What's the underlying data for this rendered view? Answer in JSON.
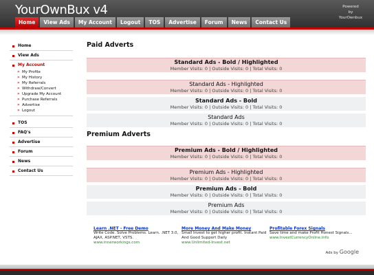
{
  "header": {
    "logo": "YourOwnBux v4",
    "powered": [
      "Powered",
      "by",
      "YourOwnbux"
    ],
    "nav": [
      "Home",
      "View Ads",
      "My Account",
      "Logout",
      "TOS",
      "Advertise",
      "Forum",
      "News",
      "Contact Us"
    ]
  },
  "sidebar": {
    "top": [
      "Home",
      "View Ads"
    ],
    "my_account": "My Account",
    "sub": [
      "My Profile",
      "My History",
      "My Referrals",
      "Withdraw/Convert",
      "Upgrade My Account",
      "Purchase Referrals",
      "Advertise",
      "Logout"
    ],
    "bottom": [
      "TOS",
      "FAQ's",
      "Advertise",
      "Forum",
      "News",
      "Contact Us"
    ]
  },
  "paid": {
    "title": "Paid Adverts",
    "ads": [
      {
        "title": "Standard Ads - Bold / Highlighted",
        "stats": "Member Visits: 0 | Outside Visits: 0 | Total Visits: 0"
      },
      {
        "title": "Standard Ads - Highlighted",
        "stats": "Member Visits: 0 | Outside Visits: 0 | Total Visits: 0"
      },
      {
        "title": "Standard Ads - Bold",
        "stats": "Member Visits: 0 | Outside Visits: 0 | Total Visits: 0"
      },
      {
        "title": "Standard Ads",
        "stats": "Member Visits: 0 | Outside Visits: 0 | Total Visits: 0"
      }
    ]
  },
  "premium": {
    "title": "Premium Adverts",
    "ads": [
      {
        "title": "Premium Ads - Bold / Highlighted",
        "stats": "Member Visits: 0 | Outside Visits: 0 | Total Visits: 0"
      },
      {
        "title": "Premium Ads - Highlighted",
        "stats": "Member Visits: 0 | Outside Visits: 0 | Total Visits: 0"
      },
      {
        "title": "Premium Ads - Bold",
        "stats": "Member Visits: 0 | Outside Visits: 0 | Total Visits: 0"
      },
      {
        "title": "Premium Ads",
        "stats": "Member Visits: 0 | Outside Visits: 0 | Total Visits: 0"
      }
    ]
  },
  "google_ads": [
    {
      "title": "Learn .NET - Free Demo",
      "desc": "Write Code. Solve Problems. Learn. .NET 3.0, AJAX, ASP.NET, VSTS.",
      "url": "www.innerworkings.com"
    },
    {
      "title": "More Money And Make Money",
      "desc": "Small Invest to get higher profit. Instant Paid And Good Support Daily",
      "url": "www.Unlimited-Invest.net"
    },
    {
      "title": "Profitable Forex Signals",
      "desc": "Save time and make Profit Honest Signals...",
      "url": "www.InvestCurrencyOnline.info"
    }
  ],
  "adsby": {
    "prefix": "Ads by",
    "brand": "Google"
  }
}
